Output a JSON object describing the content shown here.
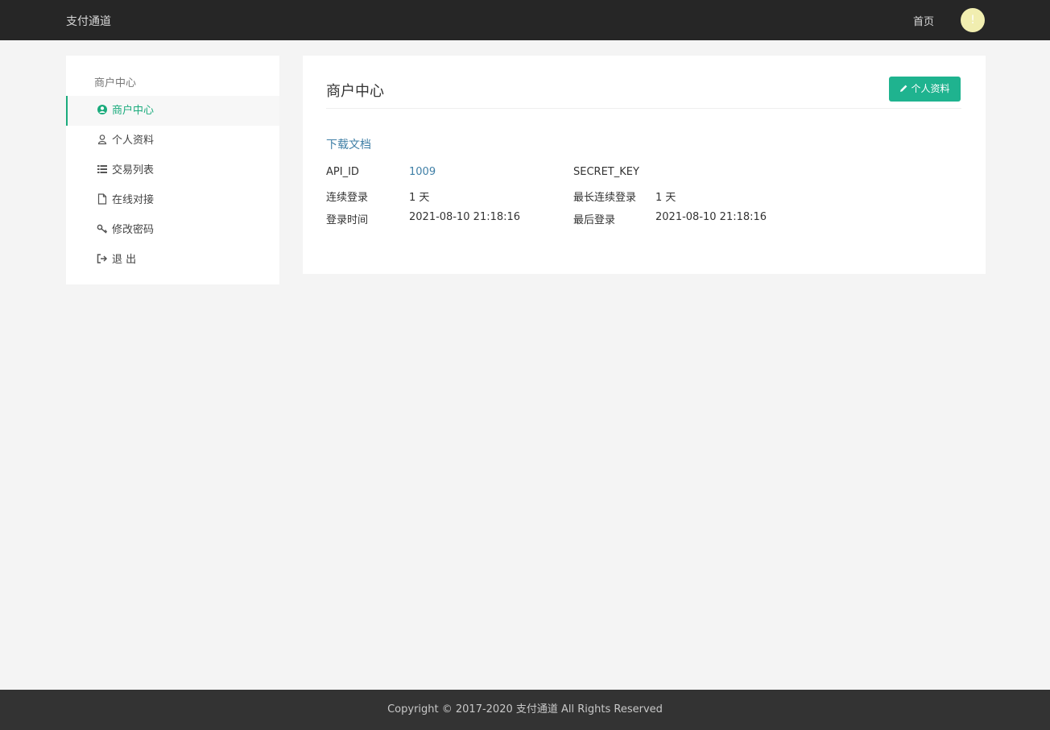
{
  "topbar": {
    "brand": "支付通道",
    "home_label": "首页",
    "avatar_text": "!"
  },
  "sidebar": {
    "title": "商户中心",
    "items": [
      {
        "label": "商户中心",
        "icon": "user-circle-icon",
        "active": true
      },
      {
        "label": "个人资料",
        "icon": "user-icon",
        "active": false
      },
      {
        "label": "交易列表",
        "icon": "list-icon",
        "active": false
      },
      {
        "label": "在线对接",
        "icon": "file-icon",
        "active": false
      },
      {
        "label": "修改密码",
        "icon": "key-icon",
        "active": false
      },
      {
        "label": "退 出",
        "icon": "sign-out-icon",
        "active": false
      }
    ]
  },
  "main": {
    "title": "商户中心",
    "profile_button": "个人资料",
    "download_link": "下载文档",
    "info": {
      "api_id_label": "API_ID",
      "api_id_value": "1009",
      "secret_key_label": "SECRET_KEY",
      "consecutive_login_label": "连续登录",
      "consecutive_login_value": "1 天",
      "longest_consecutive_label": "最长连续登录",
      "longest_consecutive_value": "1 天",
      "login_time_label": "登录时间",
      "login_time_value": "2021-08-10 21:18:16",
      "last_login_label": "最后登录",
      "last_login_value": "2021-08-10 21:18:16"
    }
  },
  "footer": {
    "copyright": "Copyright © 2017-2020 支付通道 All Rights Reserved"
  },
  "colors": {
    "topbar": "#262626",
    "accent": "#1aab7c",
    "button": "#1fb38f",
    "link": "#3f7fa6",
    "footer": "#333333"
  }
}
